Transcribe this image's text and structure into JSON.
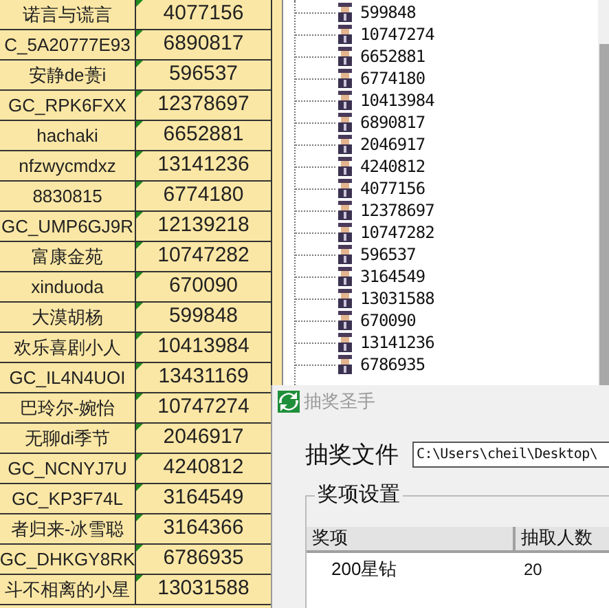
{
  "spreadsheet": {
    "rows": [
      {
        "cells": [
          "诺言与谎言",
          "4077156"
        ],
        "flagged": true
      },
      {
        "cells": [
          "C_5A20777E93",
          "6890817"
        ],
        "flagged": true
      },
      {
        "cells": [
          "安静de蒉i",
          "596537"
        ],
        "flagged": true
      },
      {
        "cells": [
          "GC_RPK6FXX",
          "12378697"
        ],
        "flagged": true
      },
      {
        "cells": [
          "hachaki",
          "6652881"
        ],
        "flagged": true
      },
      {
        "cells": [
          "nfzwycmdxz",
          "13141236"
        ],
        "flagged": true
      },
      {
        "cells": [
          "8830815",
          "6774180"
        ],
        "flagged": true
      },
      {
        "cells": [
          "GC_UMP6GJ9R",
          "12139218"
        ],
        "flagged": true
      },
      {
        "cells": [
          "富康金苑",
          "10747282"
        ],
        "flagged": true
      },
      {
        "cells": [
          "xinduoda",
          "670090"
        ],
        "flagged": true
      },
      {
        "cells": [
          "大漠胡杨",
          "599848"
        ],
        "flagged": true
      },
      {
        "cells": [
          "欢乐喜剧小人",
          "10413984"
        ],
        "flagged": true
      },
      {
        "cells": [
          "GC_IL4N4UOI",
          "13431169"
        ],
        "flagged": true
      },
      {
        "cells": [
          "巴玲尔-婉怡",
          "10747274"
        ],
        "flagged": true
      },
      {
        "cells": [
          "无聊di季节",
          "2046917"
        ],
        "flagged": true
      },
      {
        "cells": [
          "GC_NCNYJ7U",
          "4240812"
        ],
        "flagged": true
      },
      {
        "cells": [
          "GC_KP3F74L",
          "3164549"
        ],
        "flagged": true
      },
      {
        "cells": [
          "者归来-冰雪聪",
          "3164366"
        ],
        "flagged": true
      },
      {
        "cells": [
          "GC_DHKGY8RK",
          "6786935"
        ],
        "flagged": true
      },
      {
        "cells": [
          "斗不相离的小星",
          "13031588"
        ],
        "flagged": true
      }
    ]
  },
  "tree": {
    "items": [
      "599848",
      "10747274",
      "6652881",
      "6774180",
      "10413984",
      "6890817",
      "2046917",
      "4240812",
      "4077156",
      "12378697",
      "10747282",
      "596537",
      "3164549",
      "13031588",
      "670090",
      "13141236",
      "6786935"
    ]
  },
  "dialog": {
    "title": "抽奖圣手",
    "file_label": "抽奖文件",
    "file_path": "C:\\Users\\cheil\\Desktop\\",
    "group_title": "奖项设置",
    "table": {
      "columns": [
        "奖项",
        "抽取人数"
      ],
      "rows": [
        {
          "prize": "200星钻",
          "count": "20"
        }
      ]
    }
  }
}
